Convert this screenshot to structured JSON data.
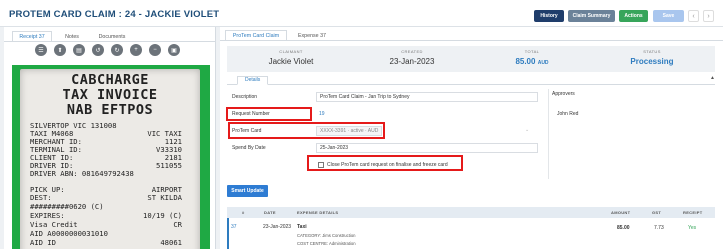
{
  "header": {
    "title": "PROTEM CARD CLAIM : 24 - JACKIE VIOLET",
    "history_label": "History",
    "claim_summary_label": "Claim Summary",
    "actions_label": "Actions",
    "save_label": "Save",
    "prev_glyph": "‹",
    "next_glyph": "›"
  },
  "left_tabs": [
    {
      "label": "Receipt 37"
    },
    {
      "label": "Notes"
    },
    {
      "label": "Documents"
    }
  ],
  "viewer_tools": [
    {
      "icon": "menu-icon",
      "glyph": "☰"
    },
    {
      "icon": "upload-icon",
      "glyph": "⬆"
    },
    {
      "icon": "document-icon",
      "glyph": "▤"
    },
    {
      "icon": "rotate-left-icon",
      "glyph": "↺"
    },
    {
      "icon": "rotate-right-icon",
      "glyph": "↻"
    },
    {
      "icon": "zoom-in-icon",
      "glyph": "+"
    },
    {
      "icon": "zoom-out-icon",
      "glyph": "−"
    },
    {
      "icon": "fit-icon",
      "glyph": "▣"
    }
  ],
  "receipt": {
    "big_lines": [
      "CABCHARGE",
      "TAX INVOICE",
      "NAB EFTPOS"
    ],
    "lines": [
      {
        "left": "SILVERTOP VIC 131008",
        "right": ""
      },
      {
        "left": "TAXI M4068",
        "right": "VIC TAXI"
      },
      {
        "left": "MERCHANT ID:",
        "right": "1121"
      },
      {
        "left": "TERMINAL ID:",
        "right": "V33310"
      },
      {
        "left": "CLIENT ID:",
        "right": "2181"
      },
      {
        "left": "DRIVER ID:",
        "right": "511055"
      },
      {
        "left": "DRIVER ABN: 081649792438",
        "right": ""
      },
      {
        "left": "",
        "right": ""
      },
      {
        "left": "PICK UP:",
        "right": "AIRPORT"
      },
      {
        "left": "DEST:",
        "right": "ST KILDA"
      },
      {
        "left": "#########0620 (C)",
        "right": ""
      },
      {
        "left": "EXPIRES:",
        "right": "10/19 (C)"
      },
      {
        "left": "Visa Credit",
        "right": "CR"
      },
      {
        "left": "AID  A0000000031010",
        "right": ""
      },
      {
        "left": "AID ID",
        "right": "48061"
      }
    ]
  },
  "right_tabs": [
    {
      "label": "ProTem Card Claim"
    },
    {
      "label": "Expense 37"
    }
  ],
  "summary": {
    "claimant_label": "CLAIMANT",
    "claimant": "Jackie Violet",
    "created_label": "CREATED",
    "created": "23-Jan-2023",
    "total_label": "TOTAL",
    "total_amount": "85.00",
    "total_currency": "AUD",
    "status_label": "STATUS",
    "status": "Processing"
  },
  "details": {
    "tab_label": "Details",
    "collapse_glyph": "▲",
    "description_label": "Description",
    "description": "ProTem Card Claim - Jan Trip to Sydney",
    "request_number_label": "Request Number",
    "request_number": "19",
    "protem_card_label": "ProTem Card",
    "protem_card": "XXXX-3391 · active · AUD",
    "spend_by_date_label": "Spend By Date",
    "spend_by_date": "25-Jan-2023",
    "close_card_label": "Close ProTem card request on finalise and freeze card"
  },
  "approvers": {
    "title": "Approvers",
    "names": [
      "John Red"
    ]
  },
  "smart_update_label": "Smart Update",
  "table": {
    "headers": [
      "#",
      "DATE",
      "EXPENSE DETAILS",
      "AMOUNT",
      "GST",
      "RECEIPT"
    ],
    "rows": [
      {
        "num": "37",
        "date": "23-Jan-2023",
        "title": "Taxi",
        "category": "CATEGORY: Jims Construction",
        "cost_centre": "COST CENTRE: Administration",
        "amount": "85.00",
        "gst": "7.73",
        "receipt": "Yes"
      }
    ]
  },
  "colors": {
    "accent": "#2e7cbf",
    "highlight": "#e51a1a",
    "actions": "#37a55b",
    "history": "#1f3d6b"
  }
}
